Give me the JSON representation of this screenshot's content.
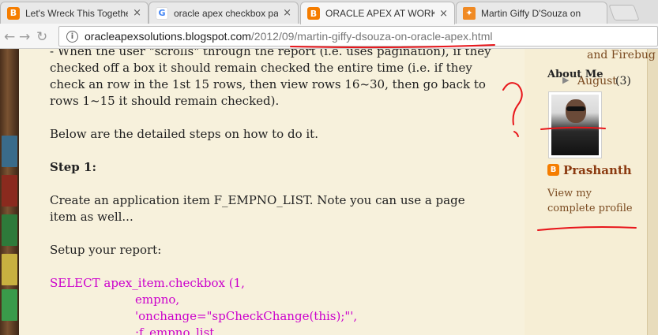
{
  "browser": {
    "tabs": [
      {
        "title": "Let's Wreck This Togethe",
        "favicon": "blogger-icon",
        "active": false
      },
      {
        "title": "oracle apex checkbox pa",
        "favicon": "google-icon",
        "active": false
      },
      {
        "title": "ORACLE APEX AT WORK:",
        "favicon": "blogger-icon",
        "active": true
      },
      {
        "title": "Martin Giffy D'Souza on",
        "favicon": "puzzle-icon",
        "active": false
      }
    ],
    "close_glyph": "×",
    "url_host": "oracleapexsolutions.blogspot.com",
    "url_path": "/2012/09/martin-giffy-dsouza-on-oracle-apex.html"
  },
  "post": {
    "para1": "- When the user \"scrolls\" through the report (i.e. uses pagination), if they checked off a box it should remain checked the entire time (i.e. if they check an row in the 1st 15 rows, then view rows 16~30, then go back to rows 1~15 it should remain checked).",
    "para2": "Below are the detailed steps on how to do it.",
    "step1": "Step 1:",
    "para3": "Create an application item F_EMPNO_LIST. Note you can use a page item as well...",
    "para4": "Setup your report:",
    "code_lines": [
      "SELECT apex_item.checkbox (1,",
      "empno,",
      "'onchange=\"spCheckChange(this);\"',",
      ":f_empno_list,"
    ]
  },
  "sidebar": {
    "archive_tail": "and Firebug",
    "archive_month": "August",
    "archive_count": "(3)",
    "about_title": "About Me",
    "profile_name": "Prashanth",
    "profile_link": "View my complete profile"
  },
  "colors": {
    "annotation": "#e8161b",
    "code": "#cc00cc",
    "accent": "#f57d00"
  }
}
